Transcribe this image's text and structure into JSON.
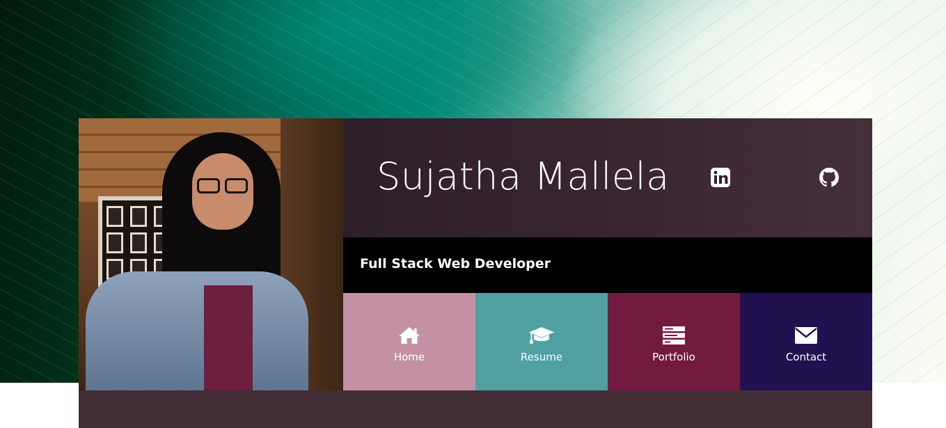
{
  "profile": {
    "name": "Sujatha Mallela",
    "tagline": "Full Stack Web Developer"
  },
  "social": [
    {
      "icon": "linkedin-icon"
    },
    {
      "icon": "github-icon"
    }
  ],
  "nav": [
    {
      "label": "Home",
      "icon": "home-icon",
      "color": "#c391a3"
    },
    {
      "label": "Resume",
      "icon": "graduation-cap-icon",
      "color": "#50a0a2"
    },
    {
      "label": "Portfolio",
      "icon": "server-icon",
      "color": "#731a3f"
    },
    {
      "label": "Contact",
      "icon": "envelope-icon",
      "color": "#21124f"
    }
  ],
  "colors": {
    "card_bg": "#432d36",
    "tagline_bg": "#000000"
  }
}
